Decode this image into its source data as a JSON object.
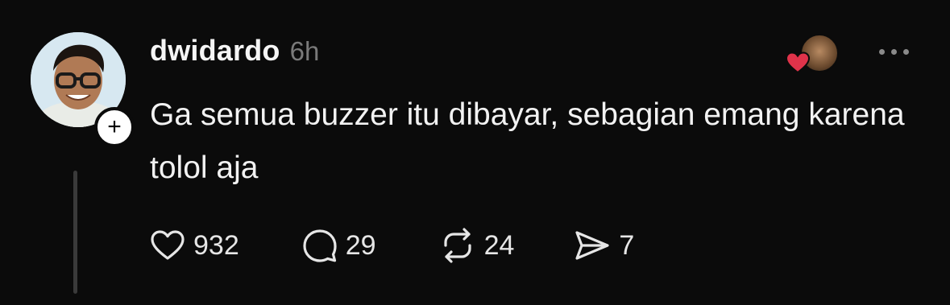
{
  "post": {
    "username": "dwidardo",
    "time": "6h",
    "text": "Ga semua buzzer itu dibayar, sebagian emang karena tolol aja",
    "follow_badge": "+",
    "icons": {
      "follow": "plus-icon",
      "liked_by": "heart-icon",
      "more": "more-icon",
      "like": "heart-outline-icon",
      "reply": "comment-icon",
      "repost": "repost-icon",
      "share": "send-icon"
    },
    "stats": {
      "likes": "932",
      "replies": "29",
      "reposts": "24",
      "shares": "7"
    },
    "colors": {
      "background": "#0b0b0b",
      "heart": "#e0334a",
      "muted": "#7a7a7a"
    }
  }
}
